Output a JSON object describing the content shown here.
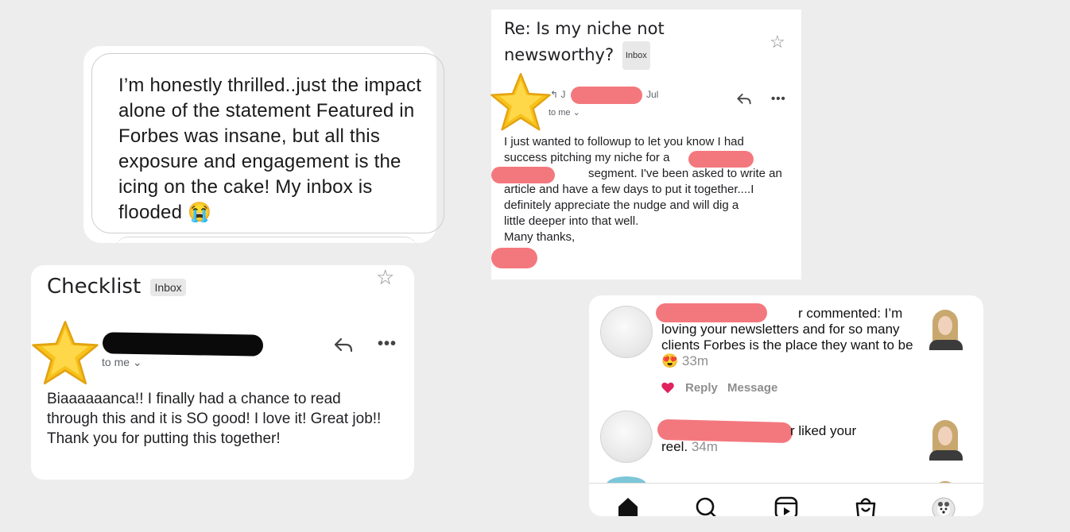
{
  "message": {
    "text": "I’m honestly thrilled..just the impact alone of the statement Featured in Forbes was insane, but all this exposure and engagement is the icing on the cake! My inbox is flooded 😭"
  },
  "checklist_email": {
    "subject": "Checklist",
    "label": "Inbox",
    "to": "to me ⌄",
    "body": "Biaaaaaanca!! I finally had a chance to read through this and it is SO good! I love it! Great job!! Thank you for putting this together!"
  },
  "news_email": {
    "subject_line1": "Re: Is my niche not",
    "subject_line2": "newsworthy?",
    "label": "Inbox",
    "sender_initial": "↰ J",
    "date": "Jul",
    "to": "to me ⌄",
    "body_lines": [
      "I just wanted to followup to let you know I had",
      "success pitching my niche for a",
      "segment. I've been asked to write an",
      "article and have a few days to put it together....I",
      "definitely appreciate the nudge and will dig a",
      "little deeper into that well.",
      "Many thanks,"
    ]
  },
  "instagram": {
    "notif1": {
      "visible_fragment": "r commented: I’m",
      "text": "loving your newsletters and for so many clients Forbes is the place they want to be",
      "emoji": "😍",
      "time": "33m",
      "reply": "Reply",
      "message": "Message"
    },
    "notif2": {
      "visible_fragment": "r liked your",
      "text": "reel.",
      "time": "34m"
    },
    "nav": [
      "home-icon",
      "search-icon",
      "reels-icon",
      "shop-icon",
      "profile-icon"
    ]
  },
  "colors": {
    "redact_pink": "#f3787e",
    "redact_black": "#0a0a0a",
    "heart": "#e0245e"
  }
}
